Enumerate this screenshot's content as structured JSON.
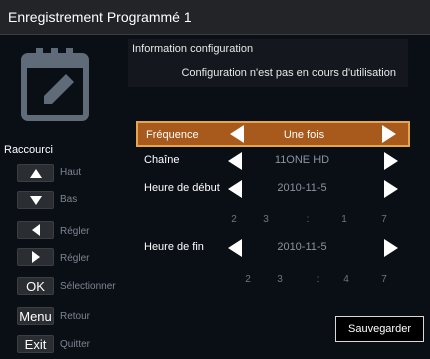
{
  "window": {
    "title": "Enregistrement Programmé 1"
  },
  "info": {
    "title": "Information configuration",
    "message": "Configuration n'est pas en cours d'utilisation"
  },
  "shortcuts": {
    "title": "Raccourci",
    "items": [
      {
        "key_icon": "arrow-up-icon",
        "label": "Haut"
      },
      {
        "key_icon": "arrow-down-icon",
        "label": "Bas"
      },
      {
        "key_icon": "arrow-left-icon",
        "label": "Régler"
      },
      {
        "key_icon": "arrow-right-icon",
        "label": "Régler"
      },
      {
        "key_text": "OK",
        "label": "Sélectionner"
      },
      {
        "key_text": "Menu",
        "label": "Retour"
      },
      {
        "key_text": "Exit",
        "label": "Quitter"
      }
    ]
  },
  "form": {
    "frequency": {
      "label": "Fréquence",
      "value": "Une fois",
      "selected": true
    },
    "channel": {
      "label": "Chaîne",
      "value": "11ONE HD"
    },
    "start": {
      "label": "Heure de début",
      "date": "2010-11-5",
      "time_digits": [
        "2",
        "3",
        ":",
        "1",
        "7"
      ]
    },
    "end": {
      "label": "Heure de fin",
      "date": "2010-11-5",
      "time_digits": [
        "2",
        "3",
        ":",
        "4",
        "7"
      ]
    }
  },
  "actions": {
    "save_label": "Sauvegarder"
  },
  "colors": {
    "background": "#0a0f16",
    "selected_row": "#a85a1c",
    "selected_border": "#e4a64f",
    "muted_text": "#8a93a0"
  }
}
